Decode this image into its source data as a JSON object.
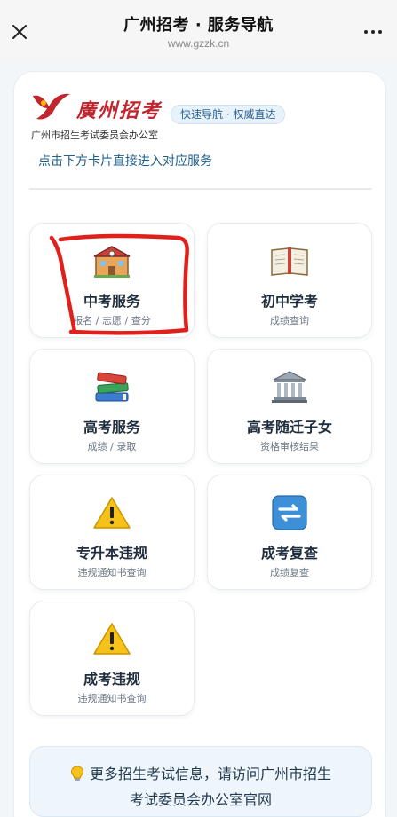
{
  "topbar": {
    "title": "广州招考 · 服务导航",
    "url": "www.gzzk.cn"
  },
  "header": {
    "logo_text": "廣州招考",
    "org_name": "广州市招生考试委员会办公室",
    "badge": "快速导航 · 权威直达",
    "hint": "点击下方卡片直接进入对应服务"
  },
  "services": [
    {
      "name": "中考服务",
      "sub": "报名 / 志愿 / 查分",
      "icon": "school-icon"
    },
    {
      "name": "初中学考",
      "sub": "成绩查询",
      "icon": "open-book-icon"
    },
    {
      "name": "高考服务",
      "sub": "成绩 / 录取",
      "icon": "books-stack-icon"
    },
    {
      "name": "高考随迁子女",
      "sub": "资格审核结果",
      "icon": "classical-building-icon"
    },
    {
      "name": "专升本违规",
      "sub": "违规通知书查询",
      "icon": "warning-icon"
    },
    {
      "name": "成考复查",
      "sub": "成绩复查",
      "icon": "refresh-arrows-icon"
    },
    {
      "name": "成考违规",
      "sub": "违规通知书查询",
      "icon": "warning-icon"
    }
  ],
  "footer": {
    "line1": "更多招生考试信息，请访问广州市招生",
    "line2": "考试委员会办公室官网"
  },
  "colors": {
    "brand_red": "#c0262d",
    "hint_blue": "#1f5f8c",
    "annotation_red": "#e0201a"
  }
}
